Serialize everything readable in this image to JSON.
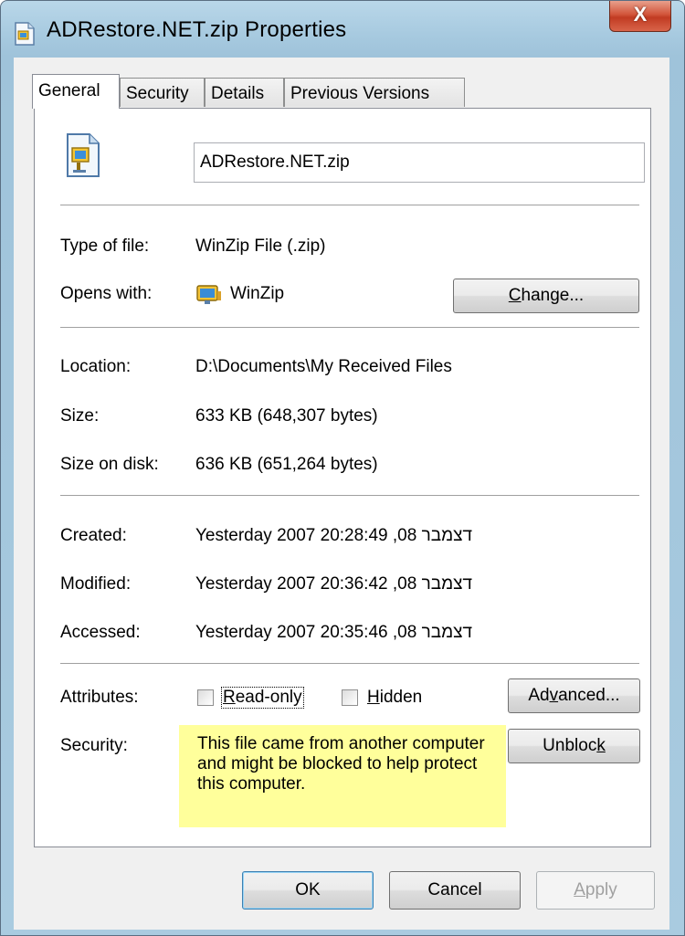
{
  "window": {
    "title": "ADRestore.NET.zip Properties",
    "close_glyph": "X"
  },
  "tabs": [
    {
      "label": "General",
      "active": true
    },
    {
      "label": "Security",
      "active": false
    },
    {
      "label": "Details",
      "active": false
    },
    {
      "label": "Previous Versions",
      "active": false
    }
  ],
  "general": {
    "file_name": "ADRestore.NET.zip",
    "type_label": "Type of file:",
    "type_value": "WinZip File (.zip)",
    "opens_label": "Opens with:",
    "opens_value": "WinZip",
    "change_button": {
      "before": "",
      "accel": "C",
      "after": "hange..."
    },
    "location_label": "Location:",
    "location_value": "D:\\Documents\\My Received Files",
    "size_label": "Size:",
    "size_value": "633 KB (648,307 bytes)",
    "disk_label": "Size on disk:",
    "disk_value": "636 KB (651,264 bytes)",
    "created_label": "Created:",
    "created_value": "Yesterday 2007 דצמבר 08, 20:28:49",
    "modified_label": "Modified:",
    "modified_value": "Yesterday 2007 דצמבר 08, 20:36:42",
    "accessed_label": "Accessed:",
    "accessed_value": "Yesterday 2007 דצמבר 08, 20:35:46",
    "attributes_label": "Attributes:",
    "readonly": {
      "before": "",
      "accel": "R",
      "after": "ead-only",
      "checked": false
    },
    "hidden": {
      "before": "",
      "accel": "H",
      "after": "idden",
      "checked": false
    },
    "advanced_button": {
      "before": "Ad",
      "accel": "v",
      "after": "anced..."
    },
    "security_label": "Security:",
    "security_note": "This file came from another computer and might be blocked to help protect this computer.",
    "unblock_button": {
      "before": "Unbloc",
      "accel": "k",
      "after": ""
    }
  },
  "footer": {
    "ok": "OK",
    "cancel": "Cancel",
    "apply": {
      "before": "",
      "accel": "A",
      "after": "pply"
    }
  },
  "colors": {
    "note_background": "#ffff9b",
    "frame": "#a6c9df",
    "close_button": "#c13b22"
  },
  "icons": {
    "title": "zip-file-icon",
    "file": "zip-file-icon",
    "opens_with": "winzip-icon"
  }
}
